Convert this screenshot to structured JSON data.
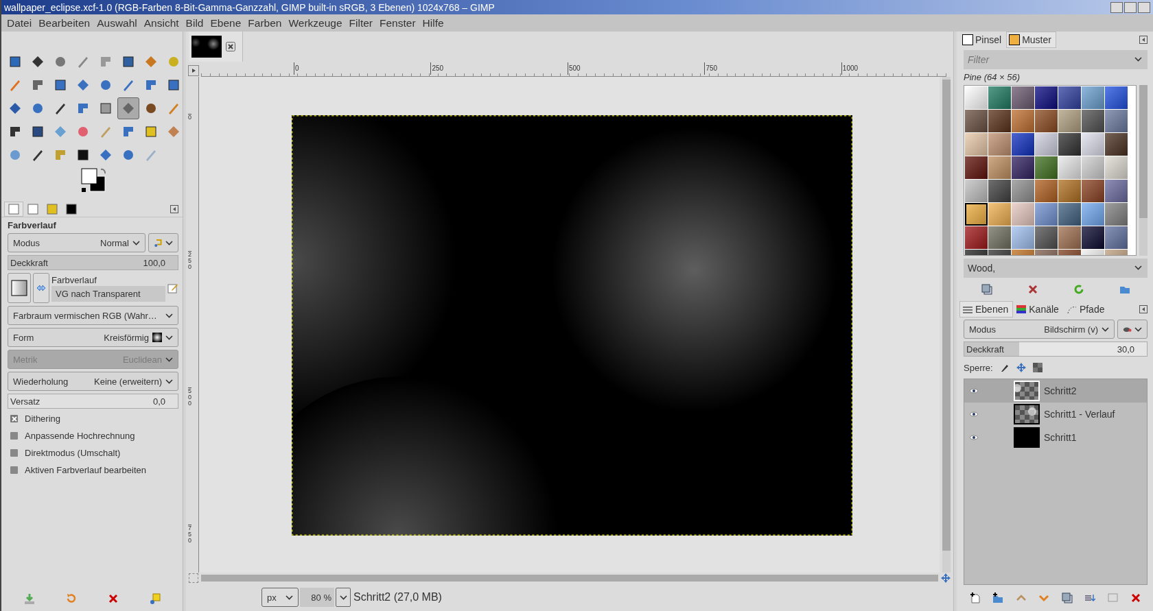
{
  "window": {
    "title": "wallpaper_eclipse.xcf-1.0 (RGB-Farben 8-Bit-Gamma-Ganzzahl, GIMP built-in sRGB, 3 Ebenen) 1024x768 – GIMP"
  },
  "menu": [
    "Datei",
    "Bearbeiten",
    "Auswahl",
    "Ansicht",
    "Bild",
    "Ebene",
    "Farben",
    "Werkzeuge",
    "Filter",
    "Fenster",
    "Hilfe"
  ],
  "toolbox": {
    "tools": [
      {
        "selected": false
      },
      {
        "selected": false
      },
      {
        "selected": false
      },
      {
        "selected": false
      },
      {
        "selected": false
      },
      {
        "selected": false
      },
      {
        "selected": false
      },
      {
        "selected": false
      },
      {
        "selected": false
      },
      {
        "selected": false
      },
      {
        "selected": false
      },
      {
        "selected": false
      },
      {
        "selected": false
      },
      {
        "selected": false
      },
      {
        "selected": false
      },
      {
        "selected": false
      },
      {
        "selected": false
      },
      {
        "selected": false
      },
      {
        "selected": false
      },
      {
        "selected": false
      },
      {
        "selected": false
      },
      {
        "selected": true
      },
      {
        "selected": false
      },
      {
        "selected": false
      },
      {
        "selected": false
      },
      {
        "selected": false
      },
      {
        "selected": false
      },
      {
        "selected": false
      },
      {
        "selected": false
      },
      {
        "selected": false
      },
      {
        "selected": false
      },
      {
        "selected": false
      },
      {
        "selected": false
      },
      {
        "selected": false
      },
      {
        "selected": false
      },
      {
        "selected": false
      },
      {
        "selected": false
      },
      {
        "selected": false
      },
      {
        "selected": false
      }
    ]
  },
  "tool_options": {
    "tabs": [
      {
        "selected": true
      },
      {
        "selected": false
      },
      {
        "selected": false
      },
      {
        "selected": false
      }
    ],
    "title": "Farbverlauf",
    "mode": {
      "label": "Modus",
      "value": "Normal"
    },
    "opacity": {
      "label": "Deckkraft",
      "value": "100,0",
      "level": 1
    },
    "gradient": {
      "label": "Farbverlauf",
      "value": "VG nach Transparent"
    },
    "selects": [
      {
        "label": "Farbraum vermischen RGB (Wahr…",
        "disabled": false
      },
      {
        "label": "Form",
        "value": "Kreisförmig",
        "disabled": false
      },
      {
        "label": "Metrik",
        "value": "Euclidean",
        "disabled": true
      },
      {
        "label": "Wiederholung",
        "value": "Keine (erweitern)",
        "disabled": false
      }
    ],
    "offset": {
      "label": "Versatz",
      "value": "0,0"
    },
    "checkboxes": [
      {
        "label": "Dithering",
        "checked": true
      },
      {
        "label": "Anpassende Hochrechnung",
        "checked": false
      },
      {
        "label": "Direktmodus (Umschalt)",
        "checked": false
      },
      {
        "label": "Aktiven Farbverlauf bearbeiten",
        "checked": false
      }
    ]
  },
  "rulers": {
    "horizontal": [
      "0",
      "250",
      "500",
      "750",
      "1000"
    ],
    "vertical": [
      "0",
      "250",
      "500",
      "750"
    ]
  },
  "status": {
    "unit": "px",
    "zoom": "80 %",
    "info": "Schritt2 (27,0 MB)"
  },
  "patterns_panel": {
    "tabs": [
      {
        "label": "Pinsel",
        "selected": false
      },
      {
        "label": "Muster",
        "selected": true
      }
    ],
    "filter": {
      "placeholder": "Filter"
    },
    "current": "Pine (64 × 56)",
    "patterns": [
      {
        "selected": false
      },
      {
        "selected": false
      },
      {
        "selected": false
      },
      {
        "selected": false
      },
      {
        "selected": false
      },
      {
        "selected": false
      },
      {
        "selected": false
      },
      {
        "selected": false
      },
      {
        "selected": false
      },
      {
        "selected": false
      },
      {
        "selected": false
      },
      {
        "selected": false
      },
      {
        "selected": false
      },
      {
        "selected": false
      },
      {
        "selected": false
      },
      {
        "selected": false
      },
      {
        "selected": false
      },
      {
        "selected": false
      },
      {
        "selected": false
      },
      {
        "selected": false
      },
      {
        "selected": false
      },
      {
        "selected": false
      },
      {
        "selected": false
      },
      {
        "selected": false
      },
      {
        "selected": false
      },
      {
        "selected": false
      },
      {
        "selected": false
      },
      {
        "selected": false
      },
      {
        "selected": false
      },
      {
        "selected": false
      },
      {
        "selected": false
      },
      {
        "selected": false
      },
      {
        "selected": false
      },
      {
        "selected": false
      },
      {
        "selected": false
      },
      {
        "selected": true
      },
      {
        "selected": false
      },
      {
        "selected": false
      },
      {
        "selected": false
      },
      {
        "selected": false
      },
      {
        "selected": false
      },
      {
        "selected": false
      },
      {
        "selected": false
      },
      {
        "selected": false
      },
      {
        "selected": false
      },
      {
        "selected": false
      },
      {
        "selected": false
      },
      {
        "selected": false
      },
      {
        "selected": false
      },
      {
        "selected": false
      },
      {
        "selected": false
      },
      {
        "selected": false
      },
      {
        "selected": false
      },
      {
        "selected": false
      },
      {
        "selected": false
      },
      {
        "selected": false
      }
    ],
    "tags": {
      "value": "Wood,"
    }
  },
  "layers_panel": {
    "tabs": [
      {
        "label": "Ebenen",
        "selected": true
      },
      {
        "label": "Kanäle",
        "selected": false
      },
      {
        "label": "Pfade",
        "selected": false
      }
    ],
    "mode": {
      "label": "Modus",
      "value": "Bildschirm (v)"
    },
    "opacity": {
      "label": "Deckkraft",
      "value": "30,0",
      "level": 0.3
    },
    "lock_label": "Sperre:",
    "layers": [
      {
        "name": "Schritt2",
        "selected": true,
        "visible": true,
        "kind": "transparent"
      },
      {
        "name": "Schritt1 - Verlauf",
        "selected": false,
        "visible": true,
        "kind": "transparent"
      },
      {
        "name": "Schritt1",
        "selected": false,
        "visible": true,
        "kind": "solid"
      }
    ]
  }
}
